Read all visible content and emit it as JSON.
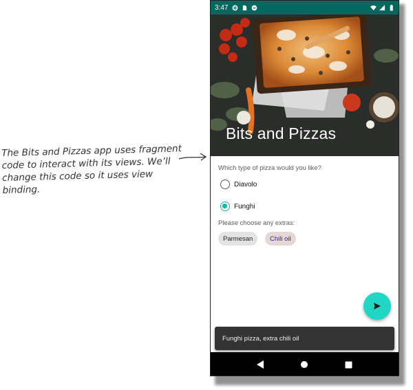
{
  "annotation": {
    "lines": [
      "The Bits and Pizzas app uses fragment",
      "code to interact with its views. We’ll",
      "change this code so it uses view binding."
    ]
  },
  "status_bar": {
    "time": "3:47"
  },
  "app": {
    "title": "Bits and Pizzas",
    "question": "Which type of pizza would you like?",
    "pizza_options": [
      {
        "label": "Diavolo",
        "selected": false
      },
      {
        "label": "Funghi",
        "selected": true
      }
    ],
    "extras_prompt": "Please choose any extras:",
    "extras": [
      {
        "label": "Parmesan",
        "checked": false
      },
      {
        "label": "Chili oil",
        "checked": true
      }
    ],
    "snackbar_text": "Funghi pizza, extra chili oil"
  },
  "colors": {
    "status_bar": "#00685e",
    "accent": "#20d7c6",
    "radio_checked": "#1bb6a5"
  },
  "icons": [
    "settings-icon",
    "sim-icon",
    "pocket-icon",
    "wifi-icon",
    "signal-icon",
    "battery-icon",
    "send-icon",
    "back-icon",
    "home-icon",
    "recents-icon"
  ]
}
